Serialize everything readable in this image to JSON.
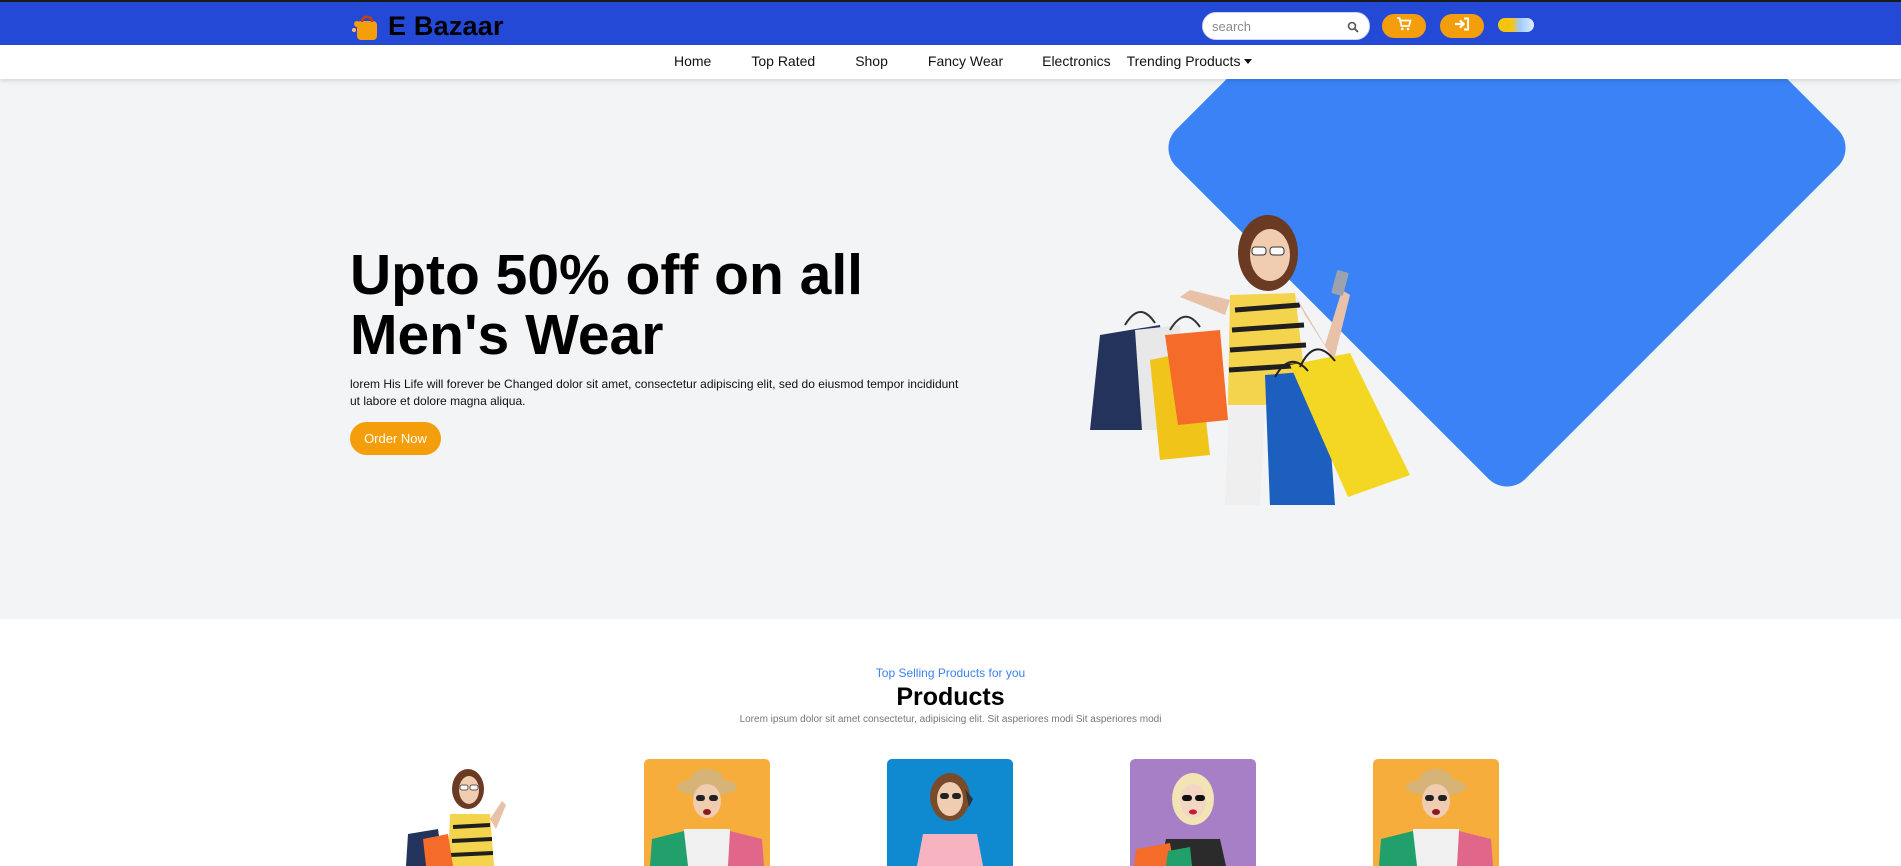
{
  "brand": {
    "name": "E Bazaar",
    "logo_icon": "shopping-bag-icon"
  },
  "search": {
    "placeholder": "search",
    "value": "",
    "icon": "search-icon"
  },
  "header_buttons": [
    {
      "icon": "cart-icon"
    },
    {
      "icon": "login-icon"
    }
  ],
  "theme_toggle": {
    "icon": "sun-cloud-toggle"
  },
  "nav": {
    "items": [
      {
        "label": "Home"
      },
      {
        "label": "Top Rated"
      },
      {
        "label": "Shop"
      },
      {
        "label": "Fancy Wear"
      },
      {
        "label": "Electronics"
      },
      {
        "label": "Trending Products",
        "icon": "caret-down-icon"
      }
    ]
  },
  "hero": {
    "headline_line1": "Upto 50% off on all",
    "headline_line2": "Men's Wear",
    "description": "lorem His Life will forever be Changed dolor sit amet, consectetur adipiscing elit, sed do eiusmod tempor incididunt ut labore et dolore magna aliqua.",
    "cta_label": "Order Now"
  },
  "products_section": {
    "kicker": "Top Selling Products for you",
    "title": "Products",
    "subtitle": "Lorem ipsum dolor sit amet consectetur, adipisicing elit. Sit asperiores modi Sit asperiores modi"
  },
  "colors": {
    "header_blue": "#2349d6",
    "accent_orange": "#f59e0b",
    "hero_shape_blue": "#3b82f6",
    "hero_bg": "#f3f4f6"
  }
}
